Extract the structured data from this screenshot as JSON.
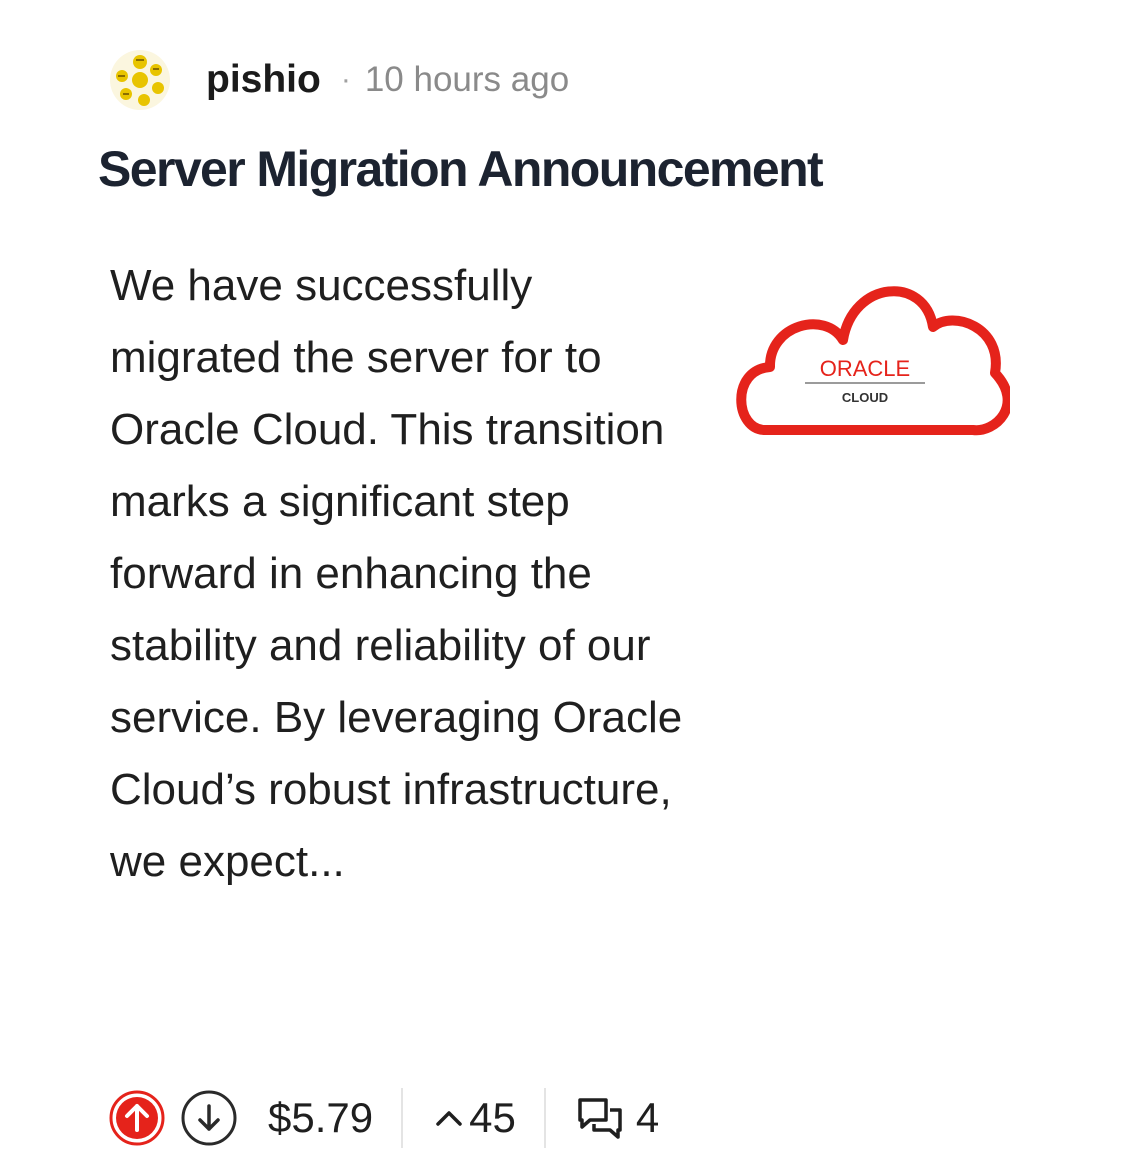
{
  "post": {
    "author": "pishio",
    "separator": "·",
    "time_ago": "10 hours ago",
    "title": "Server Migration Announcement",
    "excerpt": "We have successfully migrated the server for to Oracle Cloud. This transition marks a significant step forward in enhancing the stability and reliability of our service. By leveraging Oracle Cloud’s robust infrastructure, we expect...",
    "thumbnail": {
      "brand_text": "ORACLE",
      "sub_text": "CLOUD",
      "brand_color": "#e5231b"
    }
  },
  "footer": {
    "payout": "$5.79",
    "vote_count": "45",
    "comment_count": "4",
    "upvote_color": "#e5231b"
  },
  "icons": {
    "avatar": "community-avatar",
    "upvote": "upvote-arrow-icon",
    "downvote": "downvote-arrow-icon",
    "votes": "caret-up-icon",
    "comments": "comment-bubbles-icon"
  }
}
